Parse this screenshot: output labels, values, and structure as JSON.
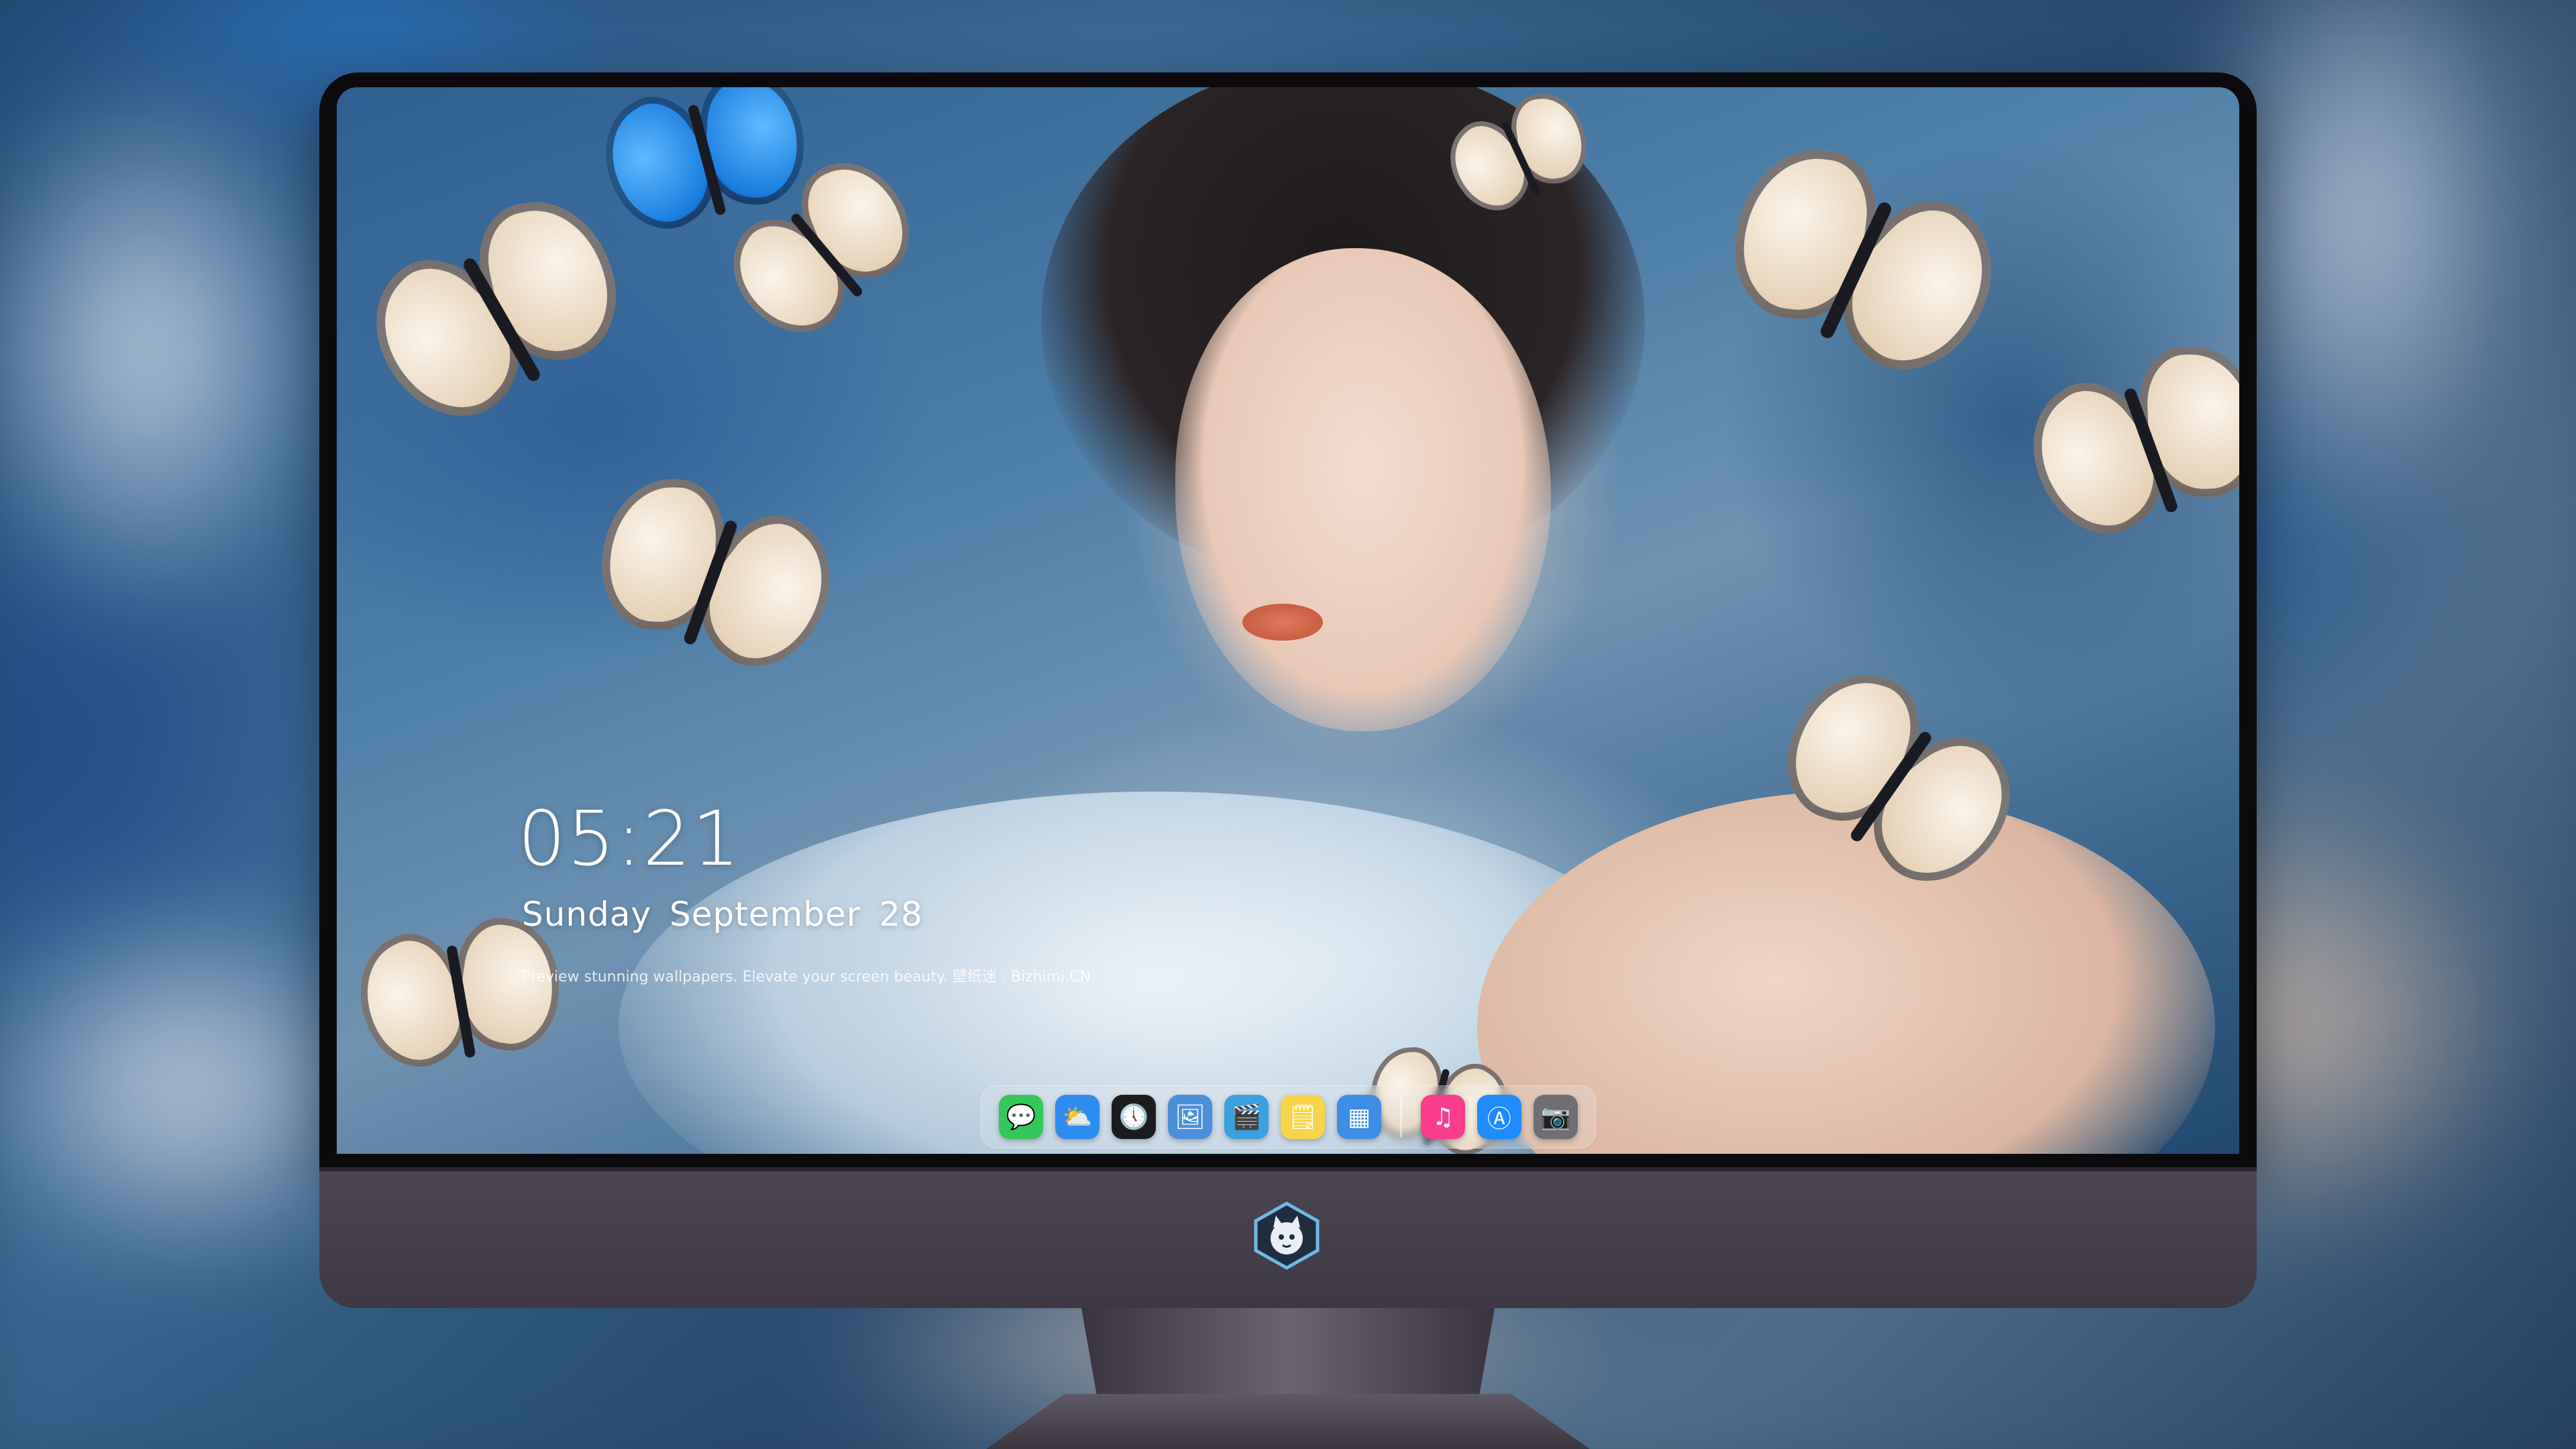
{
  "lock_screen": {
    "time": "05:21",
    "date": "Sunday September  28",
    "tagline": "Preview stunning wallpapers. Elevate your screen beauty. 壁纸迷 · Bizhimi.CN"
  },
  "dock": {
    "apps": [
      {
        "name": "Messages",
        "icon": "message-bubble-icon",
        "glyph": "💬",
        "color": "#34c759"
      },
      {
        "name": "Weather",
        "icon": "cloud-sun-icon",
        "glyph": "⛅",
        "color": "#2d8cf0"
      },
      {
        "name": "Clock",
        "icon": "clock-icon",
        "glyph": "🕔",
        "color": "#1c1c1e"
      },
      {
        "name": "Preview",
        "icon": "preview-icon",
        "glyph": "🖼",
        "color": "#4a90d9"
      },
      {
        "name": "Clips",
        "icon": "clapperboard-icon",
        "glyph": "🎬",
        "color": "#3aa0e0"
      },
      {
        "name": "Notes",
        "icon": "notes-icon",
        "glyph": "🗒",
        "color": "#f7d44a"
      },
      {
        "name": "Photo Booth",
        "icon": "photo-grid-icon",
        "glyph": "▦",
        "color": "#3c8ee6"
      },
      {
        "name": "Music",
        "icon": "music-note-icon",
        "glyph": "♫",
        "color": "#fa3c8c"
      },
      {
        "name": "App Store",
        "icon": "app-store-icon",
        "glyph": "Ⓐ",
        "color": "#1e8cff"
      },
      {
        "name": "Camera",
        "icon": "camera-icon",
        "glyph": "📷",
        "color": "#6e6e73"
      }
    ]
  },
  "chin": {
    "logo_icon": "cat-mascot-logo-icon"
  },
  "colors": {
    "screen_bezel": "#0b0b0e",
    "chin": "#4c4552",
    "text": "#ffffff"
  }
}
